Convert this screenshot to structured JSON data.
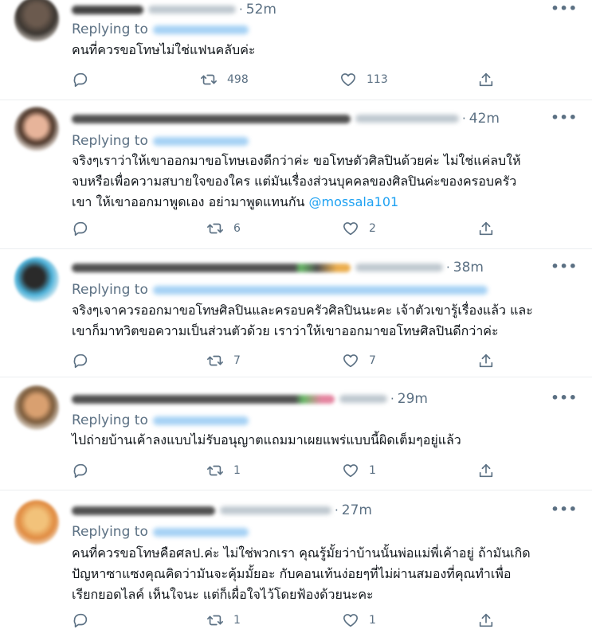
{
  "reply_prefix": "Replying to",
  "tweets": [
    {
      "time": "52m",
      "text": "คนที่ควรขอโทษไม่ใช่แฟนคลับค่ะ",
      "mention": "",
      "replies": "",
      "retweets": "498",
      "likes": "113"
    },
    {
      "time": "42m",
      "text": "จริงๆเราว่าให้เขาออกมาขอโทษเองดีกว่าค่ะ ขอโทษตัวศิลปินด้วยค่ะ ไม่ใช่แค่ลบให้\nจบหรือเพื่อความสบายใจของใคร แต่มันเรื่องส่วนบุคคลของศิลปินค่ะของครอบครัว\nเขา ให้เขาออกมาพูดเอง อย่ามาพูดแทนกัน ",
      "mention": "@mossala101",
      "replies": "",
      "retweets": "6",
      "likes": "2"
    },
    {
      "time": "38m",
      "text": "จริงๆเจาควรออกมาขอโทษศิลปินและครอบครัวศิลปินนะคะ เจ้าตัวเขารู้เรื่องแล้ว และ\nเขาก็มาทวิตขอความเป็นส่วนตัวด้วย เราว่าให้เขาออกมาขอโทษศิลปินดีกว่าค่ะ",
      "mention": "",
      "replies": "",
      "retweets": "7",
      "likes": "7"
    },
    {
      "time": "29m",
      "text": "ไปถ่ายบ้านเค้าลงแบบไม่รับอนุญาตแถมมาเผยแพร่แบบนี้ผิดเต็มๆอยู่แล้ว",
      "mention": "",
      "replies": "",
      "retweets": "1",
      "likes": "1"
    },
    {
      "time": "27m",
      "text": "คนที่ควรขอโทษคือศลป.ค่ะ ไม่ใช่พวกเรา คุณรู้มั้ยว่าบ้านนั้นพ่อแม่พี่เค้าอยู่ ถ้ามันเกิด\nปัญหาซาแซงคุณคิดว่ามันจะคุ้มมั้ยอะ กับคอนเท้นง่อยๆที่ไม่ผ่านสมองที่คุณทำเพื่อ\nเรียกยอดไลค์ เห็นใจนะ แต่ก็เผื่อใจไว้โดยฟ้องด้วยนะคะ",
      "mention": "",
      "replies": "",
      "retweets": "1",
      "likes": "1"
    }
  ]
}
